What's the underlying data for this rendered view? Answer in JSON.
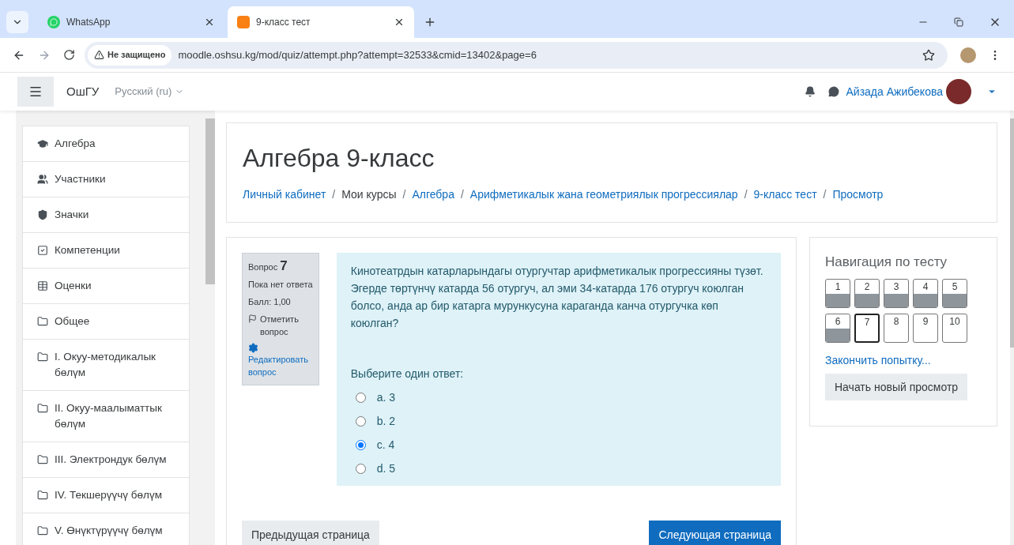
{
  "browser": {
    "tabs": [
      {
        "title": "WhatsApp",
        "selected": false
      },
      {
        "title": "9-класс тест",
        "selected": true
      }
    ],
    "security": "Не защищено",
    "url": "moodle.oshsu.kg/mod/quiz/attempt.php?attempt=32533&cmid=13402&page=6"
  },
  "navbar": {
    "site": "ОшГУ",
    "language": "Русский (ru)",
    "user": "Айзада Ажибекова"
  },
  "sidebar": {
    "items": [
      {
        "label": "Алгебра",
        "kind": "course"
      },
      {
        "label": "Участники",
        "kind": "participants"
      },
      {
        "label": "Значки",
        "kind": "badges"
      },
      {
        "label": "Компетенции",
        "kind": "competencies"
      },
      {
        "label": "Оценки",
        "kind": "grades"
      },
      {
        "label": "Общее",
        "kind": "section"
      },
      {
        "label": "I. Окуу-методикалык бөлүм",
        "kind": "section"
      },
      {
        "label": "II. Окуу-маалыматтык бөлүм",
        "kind": "section"
      },
      {
        "label": "III. Электрондук бөлүм",
        "kind": "section"
      },
      {
        "label": "IV. Текшерүүчү бөлүм",
        "kind": "section"
      },
      {
        "label": "V. Өнүктүрүүчү бөлүм",
        "kind": "section"
      }
    ]
  },
  "header": {
    "title": "Алгебра 9-класс",
    "separator": "/",
    "breadcrumb": [
      {
        "label": "Личный кабинет",
        "kind": "link"
      },
      {
        "label": "Мои курсы",
        "kind": "text"
      },
      {
        "label": "Алгебра",
        "kind": "link"
      },
      {
        "label": "Арифметикалык жана геометриялык прогрессиялар",
        "kind": "link"
      },
      {
        "label": "9-класс тест",
        "kind": "link"
      },
      {
        "label": "Просмотр",
        "kind": "link"
      }
    ]
  },
  "question": {
    "label": "Вопрос",
    "number": "7",
    "status": "Пока нет ответа",
    "mark": "Балл: 1,00",
    "flag": "Отметить вопрос",
    "edit": "Редактировать вопрос",
    "text": "Кинотеатрдын катарларындагы отургучтар арифметикалык прогрессияны түзөт. Эгерде төртүнчү катарда 56 отургуч, ал эми 34-катарда 176 отургуч коюлган болсо, анда ар бир катарга мурункусуна караганда канча отургучка көп коюлган?",
    "prompt": "Выберите один ответ:",
    "options": [
      {
        "label": "a. 3",
        "selected": false
      },
      {
        "label": "b. 2",
        "selected": false
      },
      {
        "label": "c. 4",
        "selected": true
      },
      {
        "label": "d. 5",
        "selected": false
      }
    ]
  },
  "buttons": {
    "previous": "Предыдущая страница",
    "next": "Следующая страница"
  },
  "quiz_navigation": {
    "title": "Навигация по тесту",
    "questions": [
      {
        "label": "1",
        "answered": true,
        "selected": false
      },
      {
        "label": "2",
        "answered": true,
        "selected": false
      },
      {
        "label": "3",
        "answered": true,
        "selected": false
      },
      {
        "label": "4",
        "answered": true,
        "selected": false
      },
      {
        "label": "5",
        "answered": true,
        "selected": false
      },
      {
        "label": "6",
        "answered": true,
        "selected": false
      },
      {
        "label": "7",
        "answered": false,
        "selected": true
      },
      {
        "label": "8",
        "answered": false,
        "selected": false
      },
      {
        "label": "9",
        "answered": false,
        "selected": false
      },
      {
        "label": "10",
        "answered": false,
        "selected": false
      }
    ],
    "finish": "Закончить попытку...",
    "restart": "Начать новый просмотр"
  }
}
